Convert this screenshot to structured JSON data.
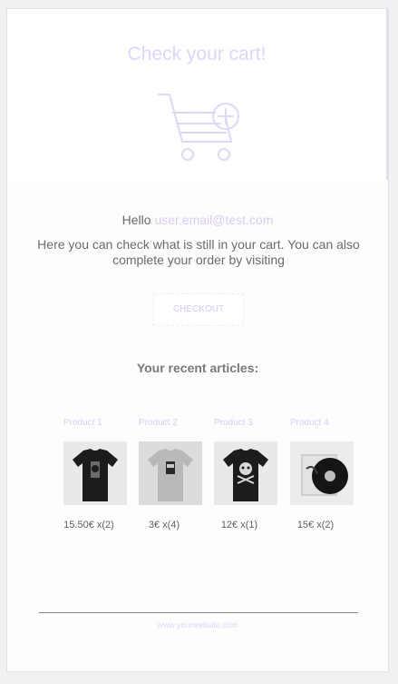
{
  "email": {
    "title": "Check your cart!",
    "hello_prefix": "Hello",
    "recipient_email": "user.email@test.com",
    "description": "Here you can check what is still in your cart. You can also complete your order by visiting",
    "checkout_label": "CHECKOUT",
    "recent_heading": "Your recent articles:",
    "footer_link": "www.yourwebsite.com"
  },
  "products": [
    {
      "name": "Product 1",
      "price": "15.50€ x(2)",
      "image": "black-tshirt-skull-icon"
    },
    {
      "name": "Product 2",
      "price": "3€ x(4)",
      "image": "grey-tshirt-icon"
    },
    {
      "name": "Product 3",
      "price": "12€ x(1)",
      "image": "black-tshirt-crossbones-icon"
    },
    {
      "name": "Product 4",
      "price": "15€ x(2)",
      "image": "vinyl-record-icon"
    }
  ],
  "colors": {
    "accent": "#d9ccfb",
    "text": "#6b6b6b",
    "background": "#f1f1f1"
  }
}
